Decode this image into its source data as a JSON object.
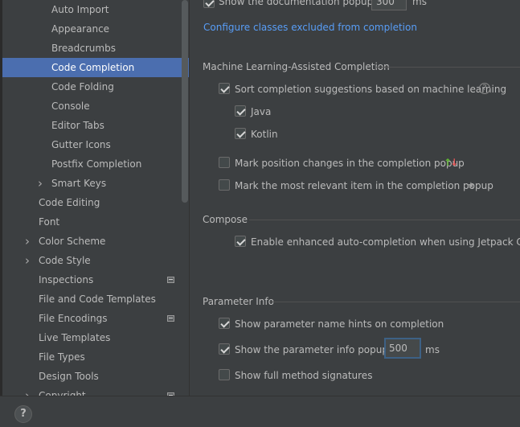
{
  "sidebar": {
    "items": [
      {
        "label": "Auto Import"
      },
      {
        "label": "Appearance"
      },
      {
        "label": "Breadcrumbs"
      },
      {
        "label": "Code Completion",
        "selected": true
      },
      {
        "label": "Code Folding"
      },
      {
        "label": "Console"
      },
      {
        "label": "Editor Tabs"
      },
      {
        "label": "Gutter Icons"
      },
      {
        "label": "Postfix Completion"
      },
      {
        "label": "Smart Keys",
        "expandable": true
      },
      {
        "label": "Code Editing"
      },
      {
        "label": "Font"
      },
      {
        "label": "Color Scheme",
        "expandable": true
      },
      {
        "label": "Code Style",
        "expandable": true
      },
      {
        "label": "Inspections",
        "badge": true
      },
      {
        "label": "File and Code Templates"
      },
      {
        "label": "File Encodings",
        "badge": true
      },
      {
        "label": "Live Templates"
      },
      {
        "label": "File Types"
      },
      {
        "label": "Design Tools"
      },
      {
        "label": "Copyright",
        "expandable": true,
        "badge": true
      }
    ]
  },
  "content": {
    "doc_popup": {
      "label": "Show the documentation popup in",
      "value": "300",
      "unit": "ms",
      "checked": true
    },
    "configure_link": "Configure classes excluded from completion",
    "ml_section": {
      "title": "Machine Learning-Assisted Completion",
      "sort_ml": {
        "label": "Sort completion suggestions based on machine learning",
        "checked": true
      },
      "java": {
        "label": "Java",
        "checked": true
      },
      "kotlin": {
        "label": "Kotlin",
        "checked": true
      },
      "mark_position": {
        "label": "Mark position changes in the completion popup",
        "checked": false,
        "icon": "up-down-arrows-icon"
      },
      "mark_relevant": {
        "label": "Mark the most relevant item in the completion popup",
        "checked": false,
        "icon": "star-icon"
      }
    },
    "compose_section": {
      "title": "Compose",
      "enhanced": {
        "label": "Enable enhanced auto-completion when using Jetpack Compose",
        "checked": true
      }
    },
    "param_section": {
      "title": "Parameter Info",
      "name_hints": {
        "label": "Show parameter name hints on completion",
        "checked": true
      },
      "info_popup": {
        "label": "Show the parameter info popup in",
        "value": "500",
        "unit": "ms",
        "checked": true
      },
      "full_sig": {
        "label": "Show full method signatures",
        "checked": false
      }
    }
  },
  "footer": {
    "help_label": "?"
  },
  "colors": {
    "selection": "#4b6eaf",
    "link": "#589df6",
    "background": "#3c3f41"
  }
}
